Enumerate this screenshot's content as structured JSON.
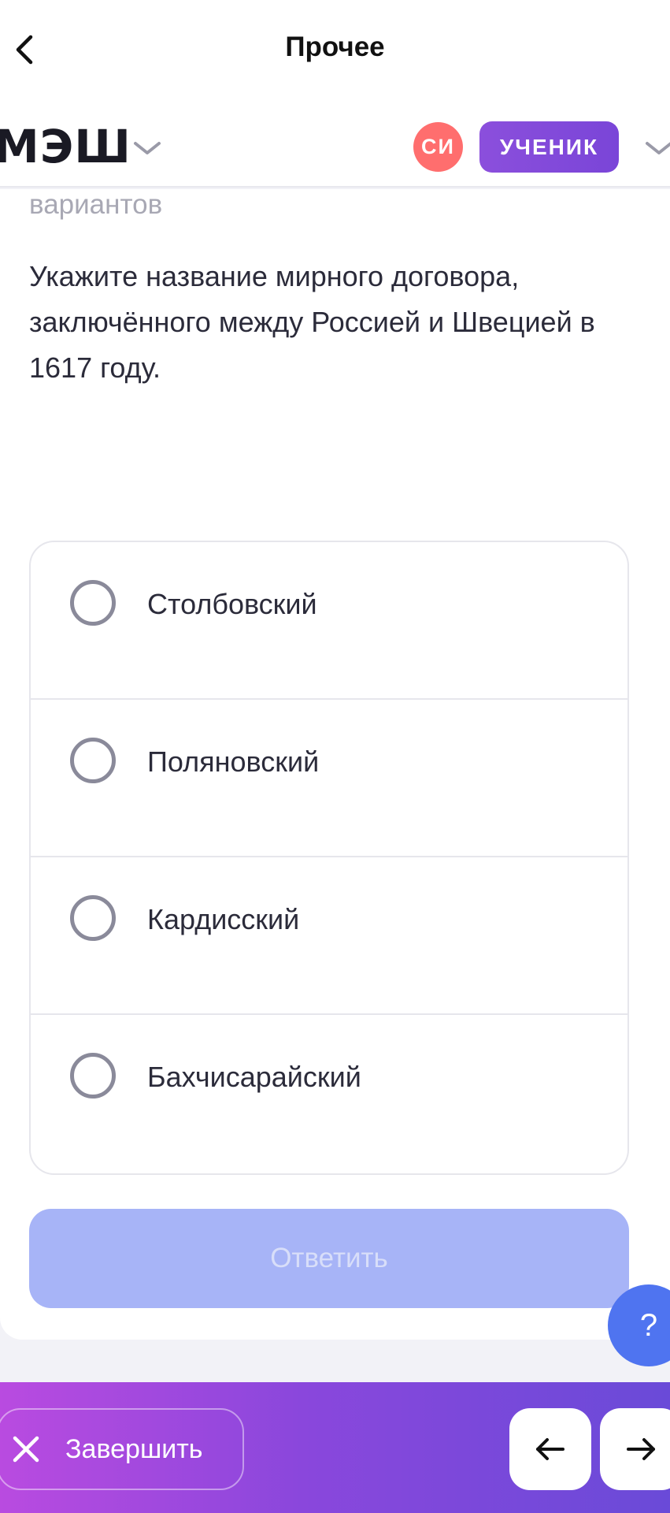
{
  "topbar": {
    "title": "Прочее"
  },
  "header": {
    "logo": "МЭШ",
    "avatar_initials": "СИ",
    "role": "УЧЕНИК"
  },
  "question": {
    "faded_line": "вариантов",
    "text": "Укажите название мирного договора, заключённого между Россией и Швецией в 1617 году.",
    "options": [
      {
        "label": "Столбовский",
        "selected": false
      },
      {
        "label": "Поляновский",
        "selected": false
      },
      {
        "label": "Кардисский",
        "selected": false
      },
      {
        "label": "Бахчисарайский",
        "selected": false
      }
    ],
    "submit_label": "Ответить"
  },
  "help": {
    "label": "?"
  },
  "bottom": {
    "finish_label": "Завершить"
  },
  "colors": {
    "accent_purple": "#8b4fdc",
    "avatar_red": "#ff6e6e",
    "submit_disabled": "#a7b4f7",
    "help_blue": "#4f74f0"
  }
}
